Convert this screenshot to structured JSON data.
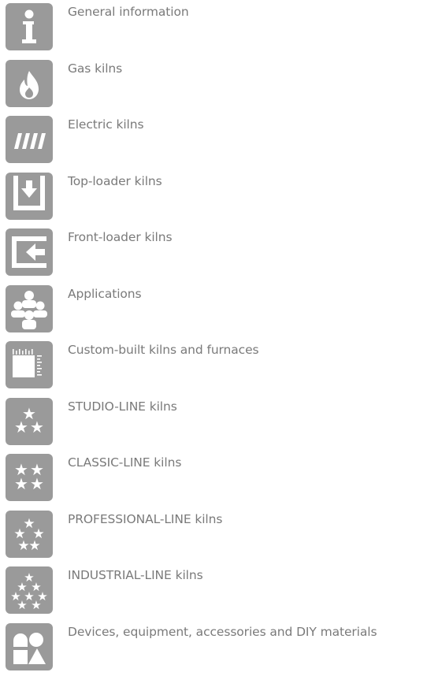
{
  "menu": {
    "items": [
      {
        "label": "General information",
        "icon": "info-icon"
      },
      {
        "label": "Gas kilns",
        "icon": "flame-icon"
      },
      {
        "label": "Electric kilns",
        "icon": "heating-elements-icon"
      },
      {
        "label": "Top-loader kilns",
        "icon": "top-loader-icon"
      },
      {
        "label": "Front-loader kilns",
        "icon": "front-loader-icon"
      },
      {
        "label": "Applications",
        "icon": "people-group-icon"
      },
      {
        "label": "Custom-built kilns and furnaces",
        "icon": "custom-build-icon"
      },
      {
        "label": "STUDIO-LINE kilns",
        "icon": "three-stars-icon"
      },
      {
        "label": "CLASSIC-LINE kilns",
        "icon": "four-stars-icon"
      },
      {
        "label": "PROFESSIONAL-LINE kilns",
        "icon": "five-stars-icon"
      },
      {
        "label": "INDUSTRIAL-LINE kilns",
        "icon": "six-stars-icon"
      },
      {
        "label": "Devices, equipment, accessories and DIY materials",
        "icon": "shapes-icon"
      }
    ]
  },
  "colors": {
    "tile": "#9a9a9a",
    "text": "#7a7a7a",
    "glyph": "#ffffff"
  }
}
